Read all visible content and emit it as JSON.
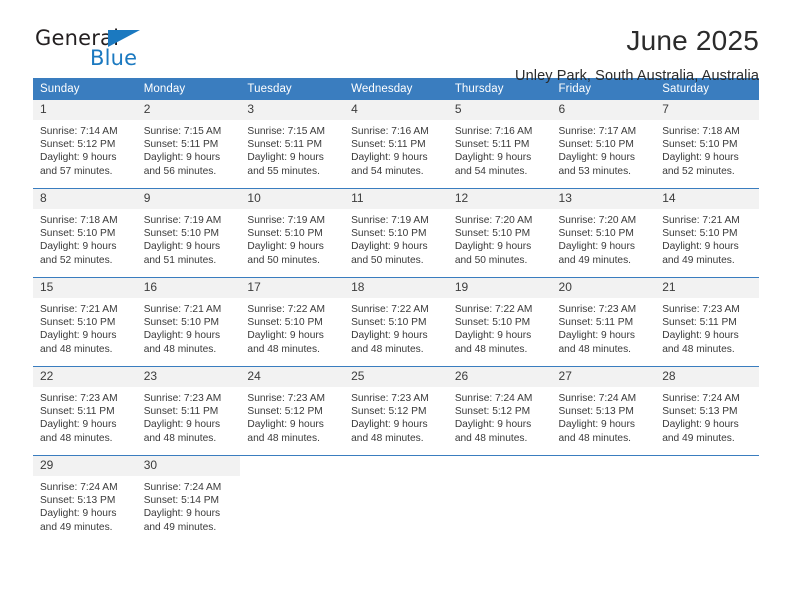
{
  "brand": {
    "name_part1": "General",
    "name_part2": "Blue",
    "flag_icon": "blue-triangle-flag",
    "accent_color": "#1b79c0"
  },
  "header": {
    "title": "June 2025",
    "subtitle": "Unley Park, South Australia, Australia"
  },
  "calendar": {
    "header_bg": "#3a7dbf",
    "daynum_bg": "#f2f2f2",
    "weekday_headers": [
      "Sunday",
      "Monday",
      "Tuesday",
      "Wednesday",
      "Thursday",
      "Friday",
      "Saturday"
    ],
    "weeks": [
      [
        {
          "day": "1",
          "sunrise": "Sunrise: 7:14 AM",
          "sunset": "Sunset: 5:12 PM",
          "daylight_line1": "Daylight: 9 hours",
          "daylight_line2": "and 57 minutes."
        },
        {
          "day": "2",
          "sunrise": "Sunrise: 7:15 AM",
          "sunset": "Sunset: 5:11 PM",
          "daylight_line1": "Daylight: 9 hours",
          "daylight_line2": "and 56 minutes."
        },
        {
          "day": "3",
          "sunrise": "Sunrise: 7:15 AM",
          "sunset": "Sunset: 5:11 PM",
          "daylight_line1": "Daylight: 9 hours",
          "daylight_line2": "and 55 minutes."
        },
        {
          "day": "4",
          "sunrise": "Sunrise: 7:16 AM",
          "sunset": "Sunset: 5:11 PM",
          "daylight_line1": "Daylight: 9 hours",
          "daylight_line2": "and 54 minutes."
        },
        {
          "day": "5",
          "sunrise": "Sunrise: 7:16 AM",
          "sunset": "Sunset: 5:11 PM",
          "daylight_line1": "Daylight: 9 hours",
          "daylight_line2": "and 54 minutes."
        },
        {
          "day": "6",
          "sunrise": "Sunrise: 7:17 AM",
          "sunset": "Sunset: 5:10 PM",
          "daylight_line1": "Daylight: 9 hours",
          "daylight_line2": "and 53 minutes."
        },
        {
          "day": "7",
          "sunrise": "Sunrise: 7:18 AM",
          "sunset": "Sunset: 5:10 PM",
          "daylight_line1": "Daylight: 9 hours",
          "daylight_line2": "and 52 minutes."
        }
      ],
      [
        {
          "day": "8",
          "sunrise": "Sunrise: 7:18 AM",
          "sunset": "Sunset: 5:10 PM",
          "daylight_line1": "Daylight: 9 hours",
          "daylight_line2": "and 52 minutes."
        },
        {
          "day": "9",
          "sunrise": "Sunrise: 7:19 AM",
          "sunset": "Sunset: 5:10 PM",
          "daylight_line1": "Daylight: 9 hours",
          "daylight_line2": "and 51 minutes."
        },
        {
          "day": "10",
          "sunrise": "Sunrise: 7:19 AM",
          "sunset": "Sunset: 5:10 PM",
          "daylight_line1": "Daylight: 9 hours",
          "daylight_line2": "and 50 minutes."
        },
        {
          "day": "11",
          "sunrise": "Sunrise: 7:19 AM",
          "sunset": "Sunset: 5:10 PM",
          "daylight_line1": "Daylight: 9 hours",
          "daylight_line2": "and 50 minutes."
        },
        {
          "day": "12",
          "sunrise": "Sunrise: 7:20 AM",
          "sunset": "Sunset: 5:10 PM",
          "daylight_line1": "Daylight: 9 hours",
          "daylight_line2": "and 50 minutes."
        },
        {
          "day": "13",
          "sunrise": "Sunrise: 7:20 AM",
          "sunset": "Sunset: 5:10 PM",
          "daylight_line1": "Daylight: 9 hours",
          "daylight_line2": "and 49 minutes."
        },
        {
          "day": "14",
          "sunrise": "Sunrise: 7:21 AM",
          "sunset": "Sunset: 5:10 PM",
          "daylight_line1": "Daylight: 9 hours",
          "daylight_line2": "and 49 minutes."
        }
      ],
      [
        {
          "day": "15",
          "sunrise": "Sunrise: 7:21 AM",
          "sunset": "Sunset: 5:10 PM",
          "daylight_line1": "Daylight: 9 hours",
          "daylight_line2": "and 48 minutes."
        },
        {
          "day": "16",
          "sunrise": "Sunrise: 7:21 AM",
          "sunset": "Sunset: 5:10 PM",
          "daylight_line1": "Daylight: 9 hours",
          "daylight_line2": "and 48 minutes."
        },
        {
          "day": "17",
          "sunrise": "Sunrise: 7:22 AM",
          "sunset": "Sunset: 5:10 PM",
          "daylight_line1": "Daylight: 9 hours",
          "daylight_line2": "and 48 minutes."
        },
        {
          "day": "18",
          "sunrise": "Sunrise: 7:22 AM",
          "sunset": "Sunset: 5:10 PM",
          "daylight_line1": "Daylight: 9 hours",
          "daylight_line2": "and 48 minutes."
        },
        {
          "day": "19",
          "sunrise": "Sunrise: 7:22 AM",
          "sunset": "Sunset: 5:10 PM",
          "daylight_line1": "Daylight: 9 hours",
          "daylight_line2": "and 48 minutes."
        },
        {
          "day": "20",
          "sunrise": "Sunrise: 7:23 AM",
          "sunset": "Sunset: 5:11 PM",
          "daylight_line1": "Daylight: 9 hours",
          "daylight_line2": "and 48 minutes."
        },
        {
          "day": "21",
          "sunrise": "Sunrise: 7:23 AM",
          "sunset": "Sunset: 5:11 PM",
          "daylight_line1": "Daylight: 9 hours",
          "daylight_line2": "and 48 minutes."
        }
      ],
      [
        {
          "day": "22",
          "sunrise": "Sunrise: 7:23 AM",
          "sunset": "Sunset: 5:11 PM",
          "daylight_line1": "Daylight: 9 hours",
          "daylight_line2": "and 48 minutes."
        },
        {
          "day": "23",
          "sunrise": "Sunrise: 7:23 AM",
          "sunset": "Sunset: 5:11 PM",
          "daylight_line1": "Daylight: 9 hours",
          "daylight_line2": "and 48 minutes."
        },
        {
          "day": "24",
          "sunrise": "Sunrise: 7:23 AM",
          "sunset": "Sunset: 5:12 PM",
          "daylight_line1": "Daylight: 9 hours",
          "daylight_line2": "and 48 minutes."
        },
        {
          "day": "25",
          "sunrise": "Sunrise: 7:23 AM",
          "sunset": "Sunset: 5:12 PM",
          "daylight_line1": "Daylight: 9 hours",
          "daylight_line2": "and 48 minutes."
        },
        {
          "day": "26",
          "sunrise": "Sunrise: 7:24 AM",
          "sunset": "Sunset: 5:12 PM",
          "daylight_line1": "Daylight: 9 hours",
          "daylight_line2": "and 48 minutes."
        },
        {
          "day": "27",
          "sunrise": "Sunrise: 7:24 AM",
          "sunset": "Sunset: 5:13 PM",
          "daylight_line1": "Daylight: 9 hours",
          "daylight_line2": "and 48 minutes."
        },
        {
          "day": "28",
          "sunrise": "Sunrise: 7:24 AM",
          "sunset": "Sunset: 5:13 PM",
          "daylight_line1": "Daylight: 9 hours",
          "daylight_line2": "and 49 minutes."
        }
      ],
      [
        {
          "day": "29",
          "sunrise": "Sunrise: 7:24 AM",
          "sunset": "Sunset: 5:13 PM",
          "daylight_line1": "Daylight: 9 hours",
          "daylight_line2": "and 49 minutes."
        },
        {
          "day": "30",
          "sunrise": "Sunrise: 7:24 AM",
          "sunset": "Sunset: 5:14 PM",
          "daylight_line1": "Daylight: 9 hours",
          "daylight_line2": "and 49 minutes."
        },
        {
          "day": "",
          "sunrise": "",
          "sunset": "",
          "daylight_line1": "",
          "daylight_line2": ""
        },
        {
          "day": "",
          "sunrise": "",
          "sunset": "",
          "daylight_line1": "",
          "daylight_line2": ""
        },
        {
          "day": "",
          "sunrise": "",
          "sunset": "",
          "daylight_line1": "",
          "daylight_line2": ""
        },
        {
          "day": "",
          "sunrise": "",
          "sunset": "",
          "daylight_line1": "",
          "daylight_line2": ""
        },
        {
          "day": "",
          "sunrise": "",
          "sunset": "",
          "daylight_line1": "",
          "daylight_line2": ""
        }
      ]
    ]
  }
}
